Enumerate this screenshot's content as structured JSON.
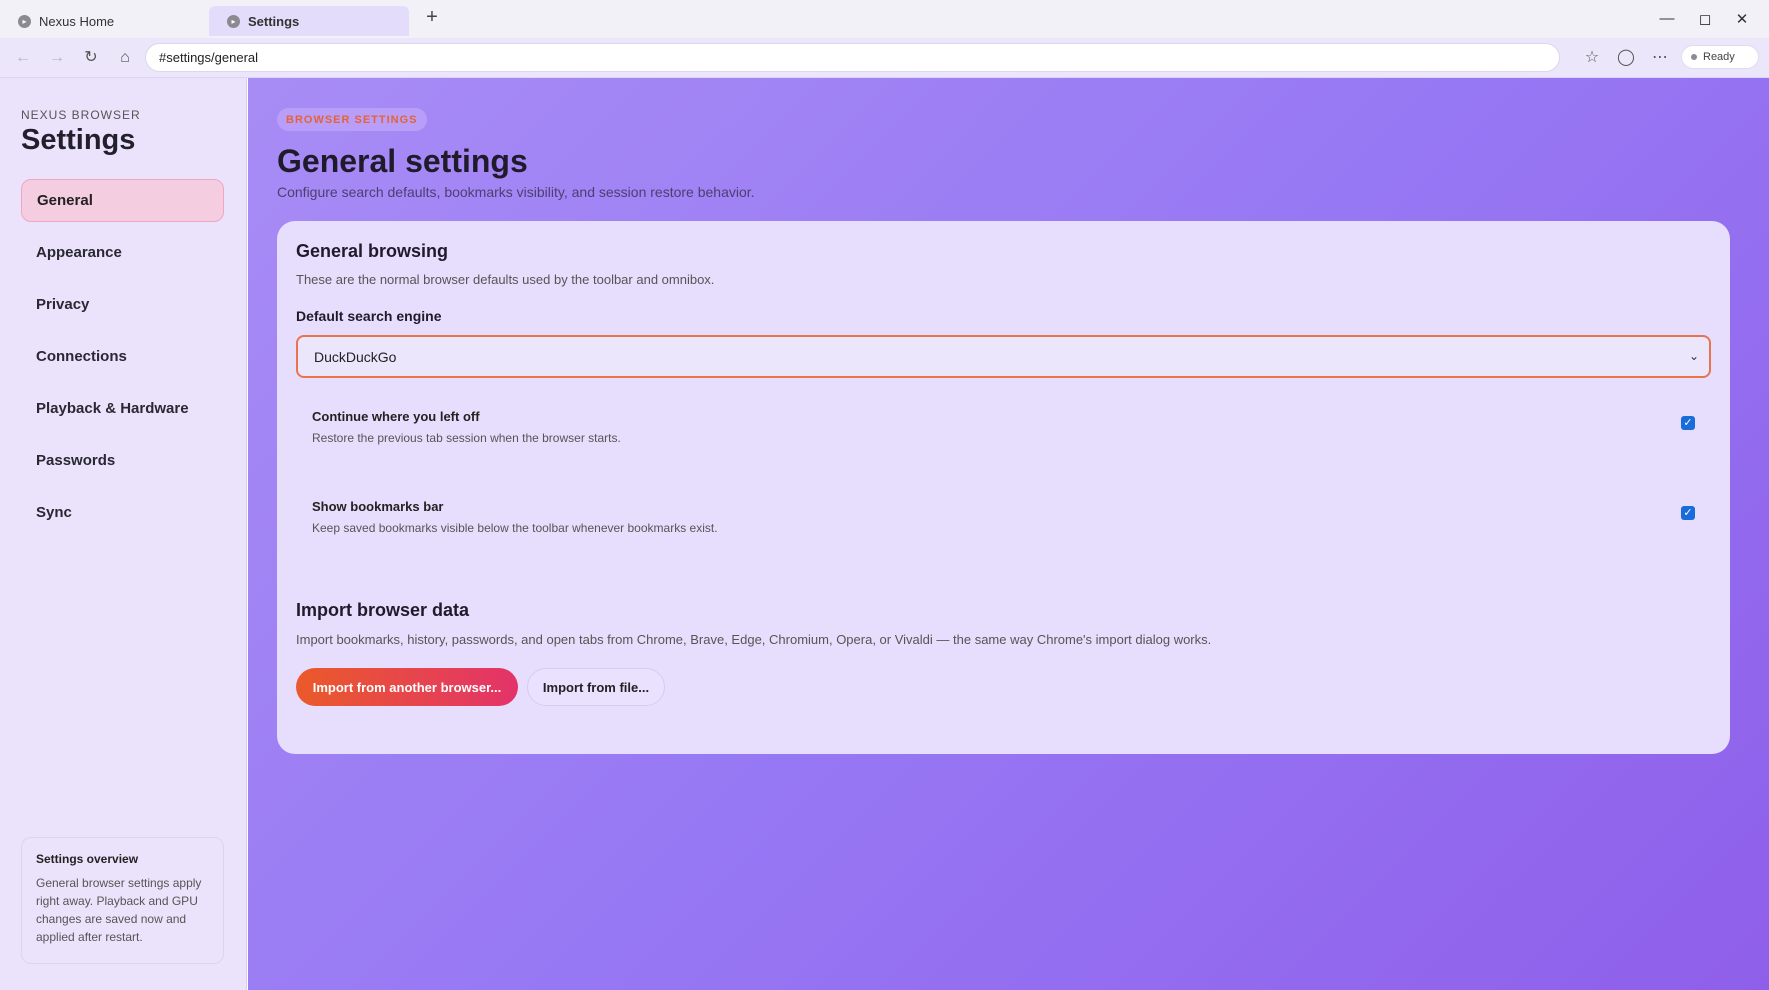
{
  "tabs": [
    {
      "label": "Nexus Home",
      "icon": "chevron-right-icon"
    },
    {
      "label": "Settings",
      "icon": "chevron-right-icon"
    }
  ],
  "toolbar": {
    "address": "#settings/general",
    "status": "Ready"
  },
  "sidebar": {
    "brand": "NEXUS BROWSER",
    "title": "Settings",
    "items": [
      {
        "label": "General"
      },
      {
        "label": "Appearance"
      },
      {
        "label": "Privacy"
      },
      {
        "label": "Connections"
      },
      {
        "label": "Playback & Hardware"
      },
      {
        "label": "Passwords"
      },
      {
        "label": "Sync"
      }
    ],
    "active_item": "General",
    "overview": {
      "title": "Settings overview",
      "text": "General browser settings apply right away. Playback and GPU changes are saved now and applied after restart."
    }
  },
  "main": {
    "badge": "BROWSER SETTINGS",
    "title": "General settings",
    "subtitle": "Configure search defaults, bookmarks visibility, and session restore behavior.",
    "general": {
      "heading": "General browsing",
      "description": "These are the normal browser defaults used by the toolbar and omnibox.",
      "search_label": "Default search engine",
      "search_value": "DuckDuckGo",
      "options": [
        {
          "title": "Continue where you left off",
          "desc": "Restore the previous tab session when the browser starts.",
          "checked": true
        },
        {
          "title": "Show bookmarks bar",
          "desc": "Keep saved bookmarks visible below the toolbar whenever bookmarks exist.",
          "checked": true
        }
      ]
    },
    "import": {
      "heading": "Import browser data",
      "description": "Import bookmarks, history, passwords, and open tabs from Chrome, Brave, Edge, Chromium, Opera, or Vivaldi — the same way Chrome's import dialog works.",
      "primary_button": "Import from another browser...",
      "secondary_button": "Import from file..."
    }
  },
  "colors": {
    "accent": "#e8744f",
    "checkbox": "#1a6cdb",
    "active_nav": "#f5cde1"
  }
}
